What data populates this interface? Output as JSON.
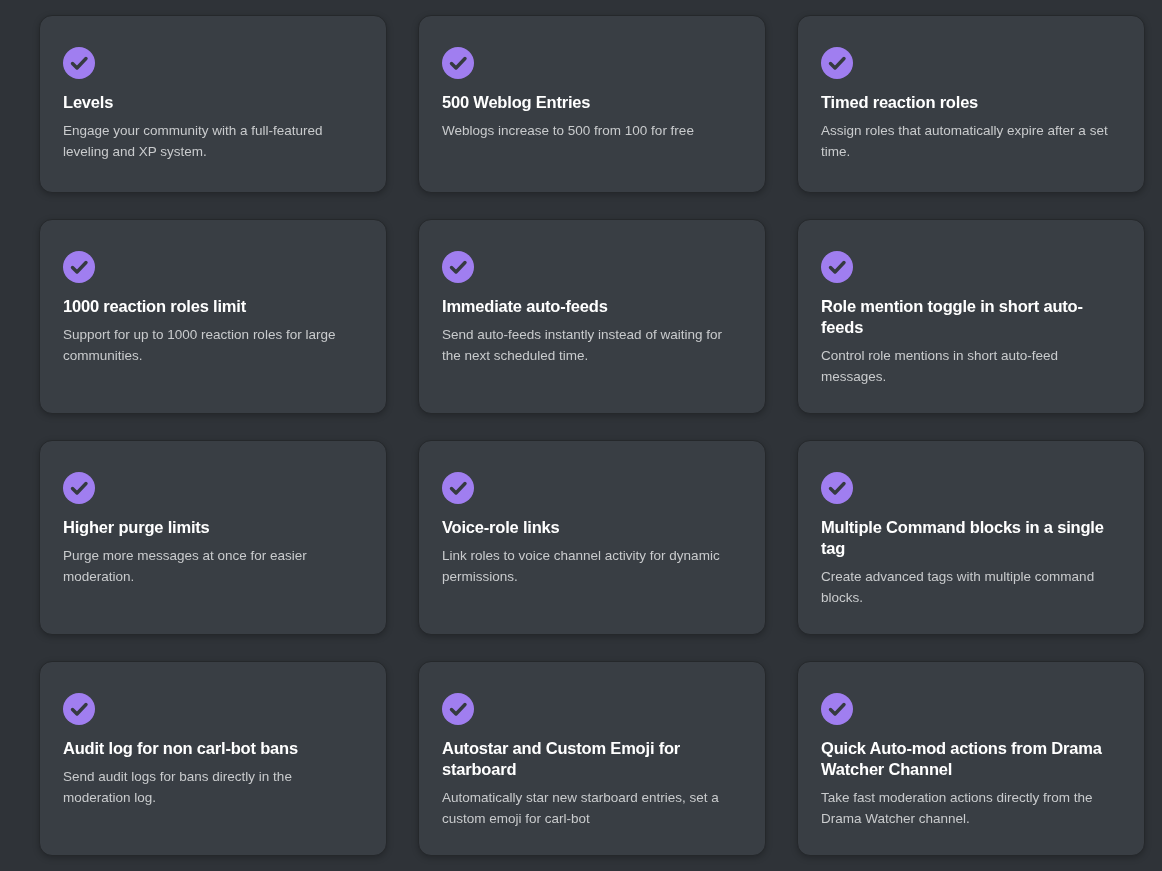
{
  "features": [
    {
      "title": "Levels",
      "description": "Engage your community with a full-featured leveling and XP system."
    },
    {
      "title": "500 Weblog Entries",
      "description": "Weblogs increase to 500 from 100 for free"
    },
    {
      "title": "Timed reaction roles",
      "description": "Assign roles that automatically expire after a set time."
    },
    {
      "title": "1000 reaction roles limit",
      "description": "Support for up to 1000 reaction roles for large communities."
    },
    {
      "title": "Immediate auto-feeds",
      "description": "Send auto-feeds instantly instead of waiting for the next scheduled time."
    },
    {
      "title": "Role mention toggle in short auto-feeds",
      "description": "Control role mentions in short auto-feed messages."
    },
    {
      "title": "Higher purge limits",
      "description": "Purge more messages at once for easier moderation."
    },
    {
      "title": "Voice-role links",
      "description": "Link roles to voice channel activity for dynamic permissions."
    },
    {
      "title": "Multiple Command blocks in a single tag",
      "description": "Create advanced tags with multiple command blocks."
    },
    {
      "title": "Audit log for non carl-bot bans",
      "description": "Send audit logs for bans directly in the moderation log."
    },
    {
      "title": "Autostar and Custom Emoji for starboard",
      "description": "Automatically star new starboard entries, set a custom emoji for carl-bot"
    },
    {
      "title": "Quick Auto-mod actions from Drama Watcher Channel",
      "description": "Take fast moderation actions directly from the Drama Watcher channel."
    }
  ]
}
